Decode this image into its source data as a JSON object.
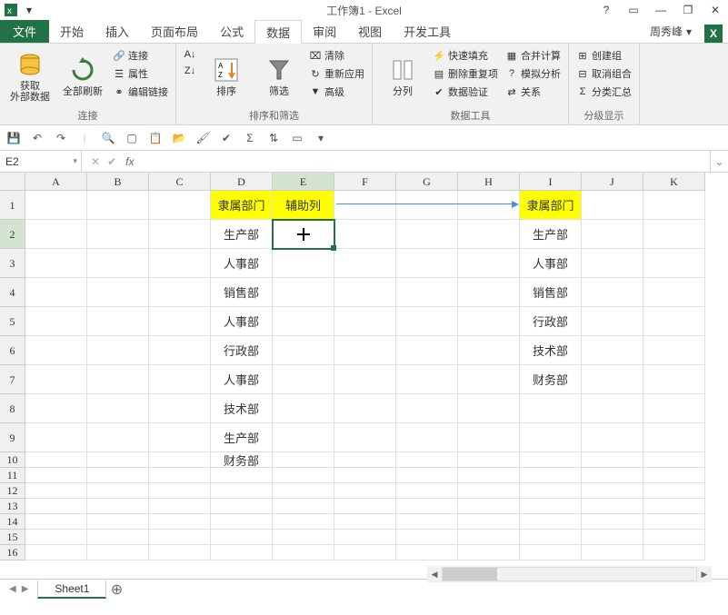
{
  "window": {
    "title": "工作簿1 - Excel"
  },
  "titlebar_controls": {
    "help": "?",
    "ribbon_opts": "▭",
    "minimize": "—",
    "restore": "❐",
    "close": "✕"
  },
  "tabs": {
    "file": "文件",
    "home": "开始",
    "insert": "插入",
    "layout": "页面布局",
    "formulas": "公式",
    "data": "数据",
    "review": "审阅",
    "view": "视图",
    "developer": "开发工具"
  },
  "user": {
    "name": "周秀峰"
  },
  "ribbon": {
    "group_connections": "连接",
    "get_external": "获取\n外部数据",
    "refresh_all": "全部刷新",
    "connections": "连接",
    "properties": "属性",
    "edit_links": "编辑链接",
    "group_sort_filter": "排序和筛选",
    "sort_az": "A→Z",
    "sort_za": "Z→A",
    "sort": "排序",
    "filter": "筛选",
    "clear": "清除",
    "reapply": "重新应用",
    "advanced": "高级",
    "group_data_tools": "数据工具",
    "text_to_cols": "分列",
    "flash_fill": "快速填充",
    "remove_dup": "删除重复项",
    "data_valid": "数据验证",
    "consolidate": "合并计算",
    "whatif": "模拟分析",
    "relations": "关系",
    "group_outline": "分级显示",
    "group_btn": "创建组",
    "ungroup": "取消组合",
    "subtotal": "分类汇总"
  },
  "formula_bar": {
    "name_box": "E2",
    "formula": ""
  },
  "columns": [
    "A",
    "B",
    "C",
    "D",
    "E",
    "F",
    "G",
    "H",
    "I",
    "J",
    "K"
  ],
  "rows_large": [
    "1",
    "2",
    "3",
    "4",
    "5",
    "6",
    "7",
    "8",
    "9"
  ],
  "rows_small": [
    "10",
    "11",
    "12",
    "13",
    "14",
    "15",
    "16"
  ],
  "cells": {
    "D1": "隶属部门",
    "E1": "辅助列",
    "I1": "隶属部门",
    "D2": "生产部",
    "I2": "生产部",
    "D3": "人事部",
    "I3": "人事部",
    "D4": "销售部",
    "I4": "销售部",
    "D5": "人事部",
    "I5": "行政部",
    "D6": "行政部",
    "I6": "技术部",
    "D7": "人事部",
    "I7": "财务部",
    "D8": "技术部",
    "D9": "生产部",
    "D10": "财务部"
  },
  "sheets": {
    "sheet1": "Sheet1"
  }
}
